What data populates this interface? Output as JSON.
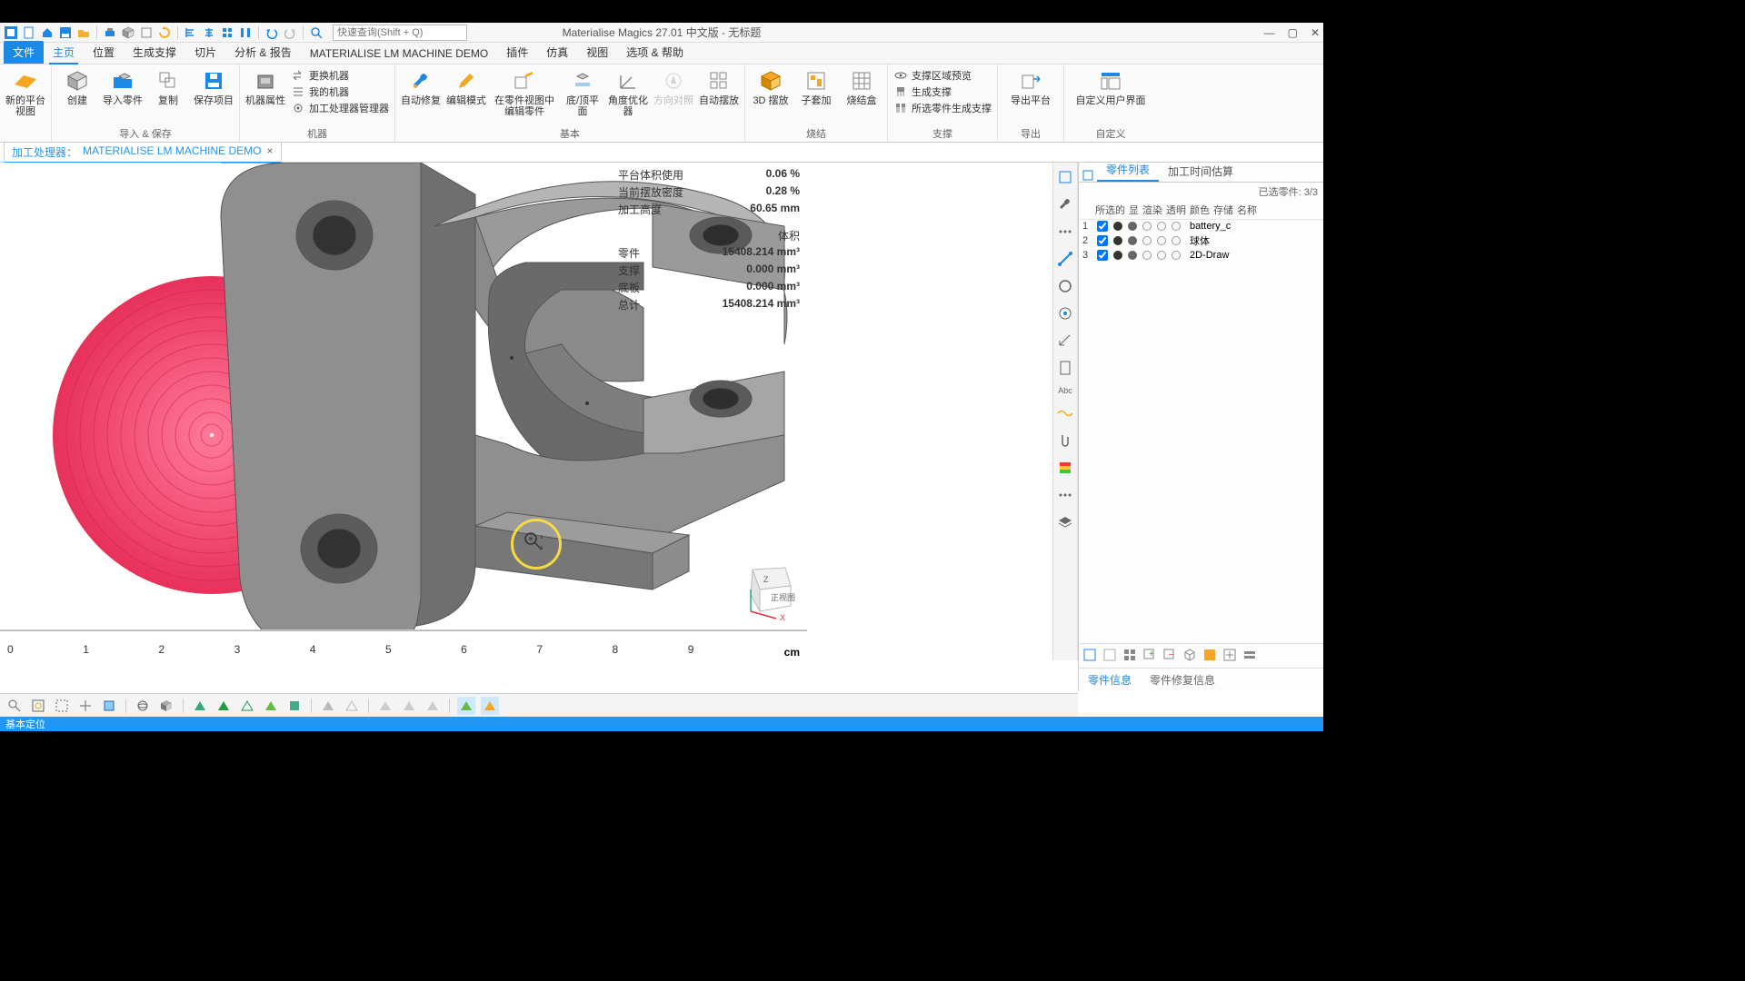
{
  "app": {
    "title": "Materialise Magics 27.01 中文版 - 无标题",
    "quick_search_placeholder": "快速查询(Shift + Q)"
  },
  "menus": {
    "file": "文件",
    "home": "主页",
    "position": "位置",
    "support": "生成支撑",
    "slice": "切片",
    "analysis": "分析 & 报告",
    "machine_demo": "MATERIALISE LM MACHINE DEMO",
    "plugins": "插件",
    "sim": "仿真",
    "view": "视图",
    "options": "选项 & 帮助"
  },
  "ribbon": {
    "new_view": "新的平台视图",
    "create": "创建",
    "import_part": "导入零件",
    "copy": "复制",
    "save_project": "保存项目",
    "machine_prop": "机器属性",
    "change_machine": "更换机器",
    "my_machines": "我的机器",
    "proc_mgr": "加工处理器管理器",
    "auto_fix": "自动修复",
    "edit_mode": "编辑模式",
    "edit_in_part_view": "在零件视图中编辑零件",
    "bottom_top_plane": "底/顶平面",
    "angle_opt": "角度优化器",
    "dir_align": "方向对照",
    "auto_place": "自动摆放",
    "place_3d": "3D 摆放",
    "sub_nest": "子套加",
    "sinter_box": "烧结盒",
    "support_preview": "支撑区域预览",
    "gen_support": "生成支撑",
    "all_parts_gen_support": "所选零件生成支撑",
    "export_platform": "导出平台",
    "custom_ui": "自定义用户界面",
    "g_import_save": "导入 & 保存",
    "g_machine": "机器",
    "g_basic": "基本",
    "g_sinter": "烧结",
    "g_support": "支撑",
    "g_export": "导出",
    "g_custom": "自定义"
  },
  "doc_tab": {
    "prefix": "加工处理器：",
    "name": "MATERIALISE LM MACHINE DEMO"
  },
  "stats": {
    "platform_vol_use": "平台体积使用",
    "platform_vol_use_val": "0.06 %",
    "current_density": "当前摆放密度",
    "current_density_val": "0.28 %",
    "build_height": "加工高度",
    "build_height_val": "60.65 mm",
    "volume_label": "体积",
    "part": "零件",
    "part_val": "15408.214 mm³",
    "support": "支撑",
    "support_val": "0.000 mm³",
    "base": "底板",
    "base_val": "0.000 mm³",
    "total": "总计",
    "total_val": "15408.214 mm³"
  },
  "rightpanel": {
    "tab_list": "零件列表",
    "tab_time": "加工时间估算",
    "selected": "已选零件: 3/3",
    "h_sel": "所选的",
    "h_vis": "显",
    "h_render": "渲染",
    "h_trans": "透明",
    "h_color": "颜色",
    "h_mem": "存储",
    "h_name": "名称",
    "rows": [
      {
        "n": "1",
        "name": "battery_c"
      },
      {
        "n": "2",
        "name": "球体"
      },
      {
        "n": "3",
        "name": "2D-Draw"
      }
    ],
    "btab_info": "零件信息",
    "btab_fix": "零件修复信息"
  },
  "ruler": {
    "nums": [
      "0",
      "1",
      "2",
      "3",
      "4",
      "5",
      "6",
      "7",
      "8",
      "9"
    ],
    "unit": "cm"
  },
  "viewcube": {
    "z": "Z",
    "front": "正视图",
    "x": "X"
  },
  "status": "基本定位"
}
